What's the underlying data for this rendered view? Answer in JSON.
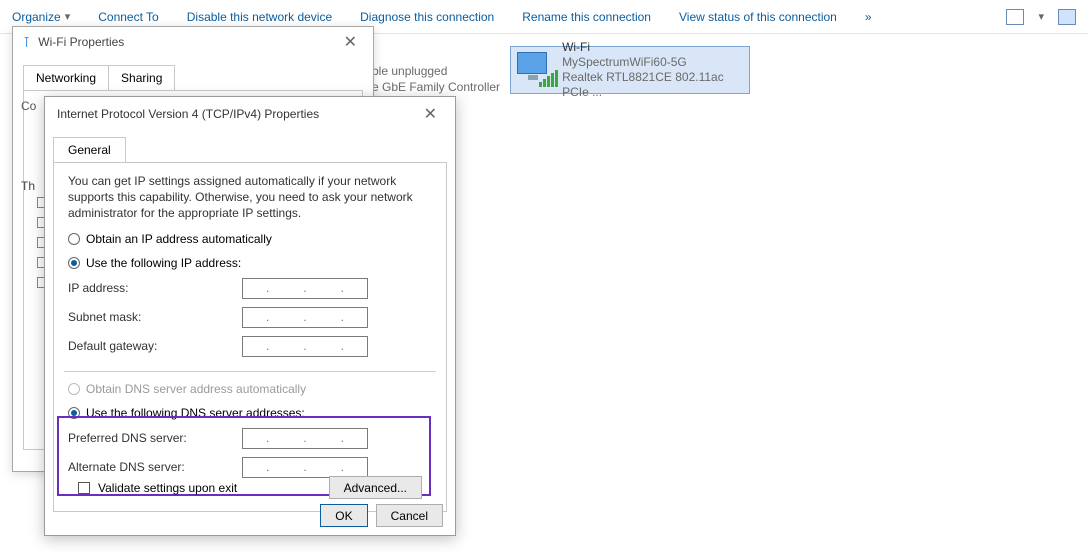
{
  "toolbar": {
    "items": [
      "Organize",
      "Connect To",
      "Disable this network device",
      "Diagnose this connection",
      "Rename this connection",
      "View status of this connection"
    ],
    "more": "»"
  },
  "adapter": {
    "name": "Wi-Fi",
    "ssid": "MySpectrumWiFi60-5G",
    "device": "Realtek RTL8821CE 802.11ac PCIe ..."
  },
  "fragment": {
    "l1": "ble unplugged",
    "l2": "e GbE Family Controller"
  },
  "wifi_dlg": {
    "title": "Wi-Fi Properties",
    "tabs": [
      "Networking",
      "Sharing"
    ],
    "co": "Co",
    "th": "Th"
  },
  "ip_dlg": {
    "title": "Internet Protocol Version 4 (TCP/IPv4) Properties",
    "tab": "General",
    "intro": "You can get IP settings assigned automatically if your network supports this capability. Otherwise, you need to ask your network administrator for the appropriate IP settings.",
    "ip_auto": "Obtain an IP address automatically",
    "ip_manual": "Use the following IP address:",
    "ip_addr": "IP address:",
    "subnet": "Subnet mask:",
    "gateway": "Default gateway:",
    "dns_auto": "Obtain DNS server address automatically",
    "dns_manual": "Use the following DNS server addresses:",
    "pref_dns": "Preferred DNS server:",
    "alt_dns": "Alternate DNS server:",
    "validate": "Validate settings upon exit",
    "advanced": "Advanced...",
    "ok": "OK",
    "cancel": "Cancel"
  }
}
